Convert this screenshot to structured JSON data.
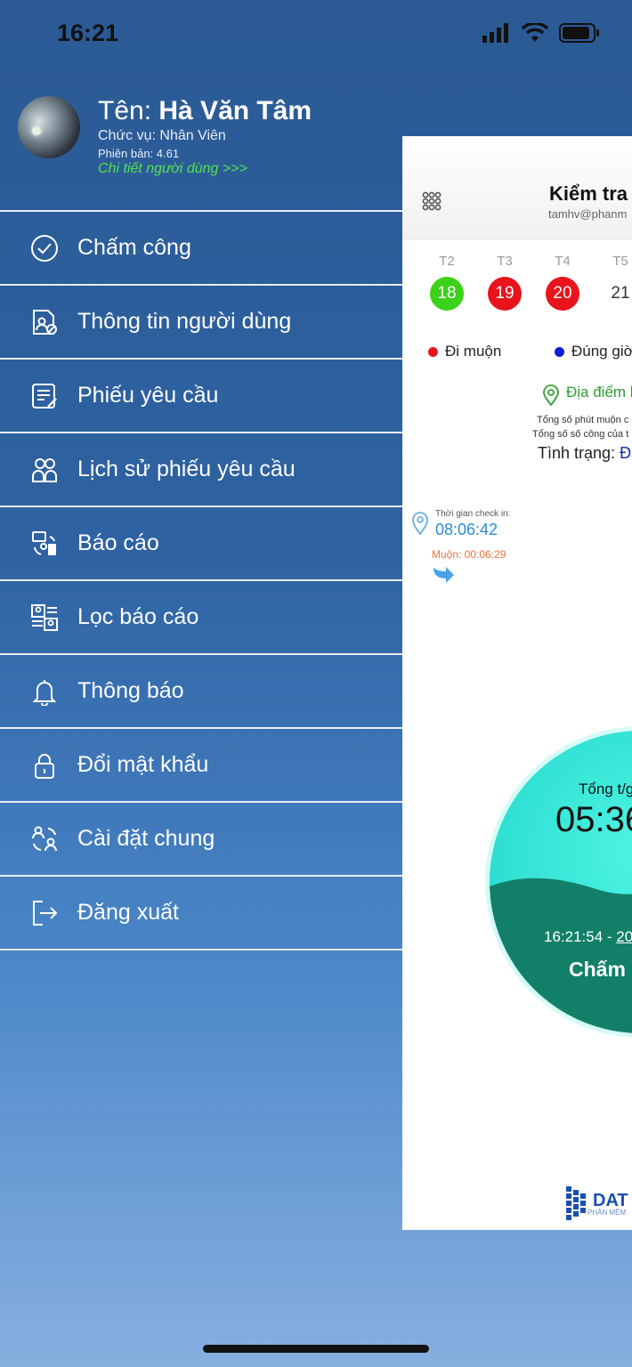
{
  "status_bar": {
    "time": "16:21"
  },
  "profile": {
    "name_prefix": "Tên: ",
    "name": "Hà Văn Tâm",
    "role": "Chức vụ: Nhân Viên",
    "version": "Phiên bản: 4.61",
    "detail_link": "Chi tiết người dùng >>>"
  },
  "menu": {
    "items": [
      {
        "label": "Chấm công",
        "icon": "check-circle-icon"
      },
      {
        "label": "Thông tin người dùng",
        "icon": "user-document-icon"
      },
      {
        "label": "Phiếu yêu cầu",
        "icon": "request-form-icon"
      },
      {
        "label": "Lịch sử phiếu yêu cầu",
        "icon": "users-history-icon"
      },
      {
        "label": "Báo cáo",
        "icon": "report-icon"
      },
      {
        "label": "Lọc báo cáo",
        "icon": "filter-report-icon"
      },
      {
        "label": "Thông báo",
        "icon": "bell-icon"
      },
      {
        "label": "Đổi mật khẩu",
        "icon": "lock-icon"
      },
      {
        "label": "Cài đặt chung",
        "icon": "settings-users-icon"
      },
      {
        "label": "Đăng xuất",
        "icon": "logout-icon"
      }
    ]
  },
  "panel": {
    "title": "Kiểm tra c",
    "email": "tamhv@phanm",
    "days": [
      {
        "label": "T2",
        "num": "18",
        "color": "#3cd11a"
      },
      {
        "label": "T3",
        "num": "19",
        "color": "#e8141c"
      },
      {
        "label": "T4",
        "num": "20",
        "color": "#e8141c"
      },
      {
        "label": "T5",
        "num": "21",
        "color": ""
      }
    ],
    "legend_late": "Đi muộn",
    "legend_ontime": "Đúng giờ",
    "location": "Địa điểm h",
    "stat_late_minutes": "Tổng số phút muộn c",
    "stat_workdays": "Tổng số số công của t",
    "state_label": "Tình trạng: ",
    "state_value": "Đã",
    "checkin_label": "Thời gian check in:",
    "checkin_time": "08:06:42",
    "late_text": "Muộn: 00:06:29",
    "total_label": "Tổng t/g",
    "total_value": "05:36",
    "range_start": "16:21:54 - ",
    "range_end": "20",
    "check_button": "Chấm c",
    "logo_text": "DAT",
    "logo_sub": "PHẦN MỀM"
  },
  "colors": {
    "late": "#e8141c",
    "on_time": "#0a1ed8",
    "accent_green": "#51e34a",
    "circle": "#2fe0d2",
    "wave": "#128069"
  }
}
